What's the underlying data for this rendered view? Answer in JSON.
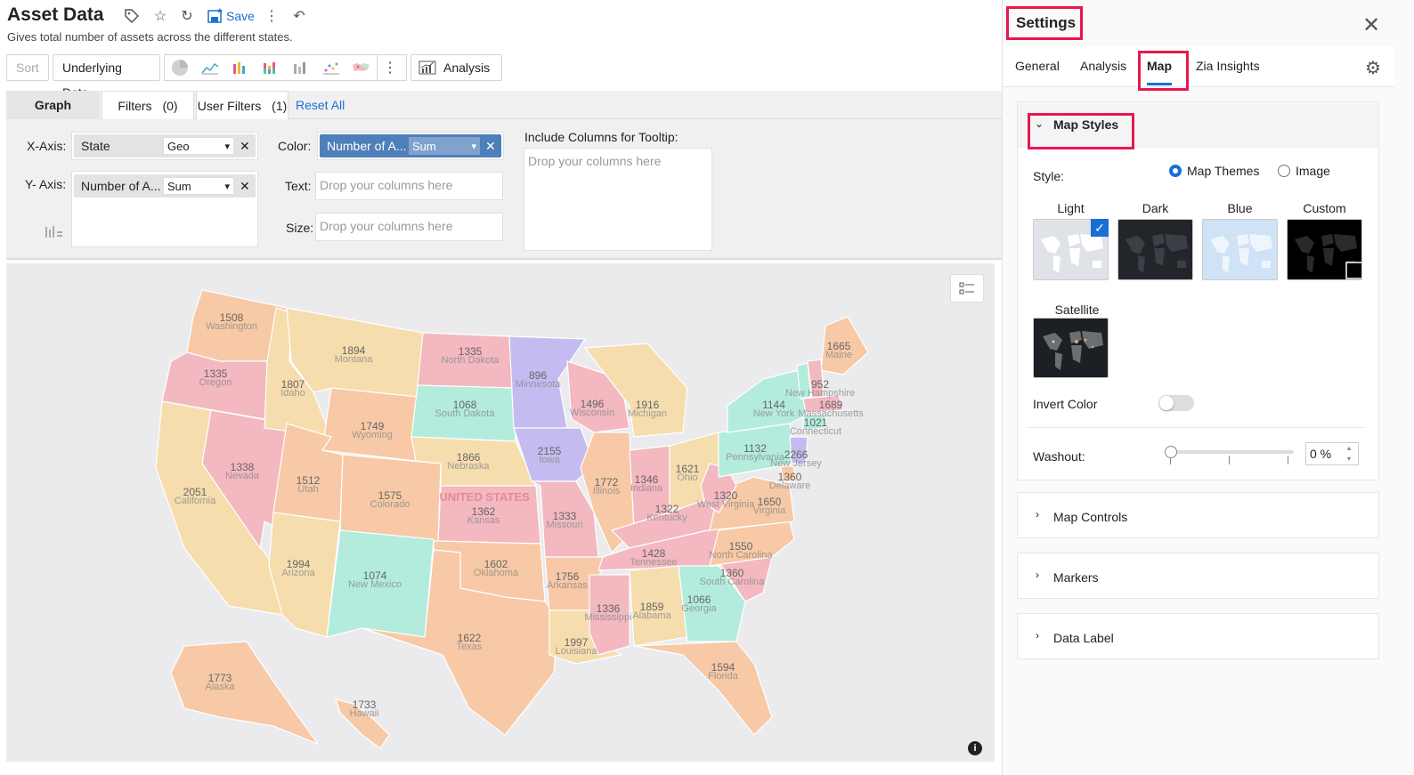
{
  "header": {
    "title": "Asset Data",
    "subtitle": "Gives total number of assets across the different states.",
    "save_label": "Save"
  },
  "toolbar": {
    "sort_label": "Sort",
    "underlying_label": "Underlying Data",
    "analysis_label": "Analysis",
    "chart_icons": [
      "pie-chart-icon",
      "line-chart-icon",
      "bar-chart-icon",
      "stacked-bar-icon",
      "column-chart-icon",
      "scatter-chart-icon",
      "map-chart-icon"
    ]
  },
  "tabs": {
    "graph": "Graph",
    "filters": "Filters",
    "filters_count": "(0)",
    "user_filters": "User Filters",
    "user_filters_count": "(1)",
    "reset_all": "Reset All"
  },
  "shelf": {
    "x_axis_label": "X-Axis:",
    "x_field": "State",
    "x_agg": "Geo",
    "y_axis_label": "Y- Axis:",
    "y_field": "Number of A...",
    "y_agg": "Sum",
    "color_label": "Color:",
    "color_field": "Number of A...",
    "color_agg": "Sum",
    "text_label": "Text:",
    "size_label": "Size:",
    "drop_placeholder": "Drop your columns here",
    "tooltip_label": "Include Columns for Tooltip:"
  },
  "map": {
    "country_label": "UNITED STATES",
    "states": [
      {
        "name": "Washington",
        "value": "1508"
      },
      {
        "name": "Oregon",
        "value": "1335"
      },
      {
        "name": "California",
        "value": "2051"
      },
      {
        "name": "Nevada",
        "value": "1338"
      },
      {
        "name": "Idaho",
        "value": "1807"
      },
      {
        "name": "Montana",
        "value": "1894"
      },
      {
        "name": "Wyoming",
        "value": "1749"
      },
      {
        "name": "Utah",
        "value": "1512"
      },
      {
        "name": "Arizona",
        "value": "1994"
      },
      {
        "name": "Colorado",
        "value": "1575"
      },
      {
        "name": "New Mexico",
        "value": "1074"
      },
      {
        "name": "North Dakota",
        "value": "1335"
      },
      {
        "name": "South Dakota",
        "value": "1068"
      },
      {
        "name": "Nebraska",
        "value": "1866"
      },
      {
        "name": "Kansas",
        "value": "1362"
      },
      {
        "name": "Oklahoma",
        "value": "1602"
      },
      {
        "name": "Texas",
        "value": "1622"
      },
      {
        "name": "Minnesota",
        "value": "896"
      },
      {
        "name": "Iowa",
        "value": "2155"
      },
      {
        "name": "Missouri",
        "value": "1333"
      },
      {
        "name": "Arkansas",
        "value": "1756"
      },
      {
        "name": "Louisiana",
        "value": "1997"
      },
      {
        "name": "Wisconsin",
        "value": "1496"
      },
      {
        "name": "Illinois",
        "value": "1772"
      },
      {
        "name": "Mississippi",
        "value": "1336"
      },
      {
        "name": "Michigan",
        "value": "1916"
      },
      {
        "name": "Indiana",
        "value": "1346"
      },
      {
        "name": "Kentucky",
        "value": "1322"
      },
      {
        "name": "Tennessee",
        "value": "1428"
      },
      {
        "name": "Alabama",
        "value": "1859"
      },
      {
        "name": "Ohio",
        "value": "1621"
      },
      {
        "name": "Georgia",
        "value": "1066"
      },
      {
        "name": "Florida",
        "value": "1594"
      },
      {
        "name": "South Carolina",
        "value": "1360"
      },
      {
        "name": "North Carolina",
        "value": "1550"
      },
      {
        "name": "Virginia",
        "value": "1650"
      },
      {
        "name": "West Virginia",
        "value": "1320"
      },
      {
        "name": "Pennsylvania",
        "value": "1132"
      },
      {
        "name": "New York",
        "value": "1144"
      },
      {
        "name": "New Jersey",
        "value": "2266"
      },
      {
        "name": "Delaware",
        "value": "1360"
      },
      {
        "name": "Maine",
        "value": "1665"
      },
      {
        "name": "New Hampshire",
        "value": "952"
      },
      {
        "name": "Massachusetts",
        "value": "1689"
      },
      {
        "name": "Connecticut",
        "value": "1021"
      },
      {
        "name": "Alaska",
        "value": "1773"
      },
      {
        "name": "Hawaii",
        "value": "1733"
      }
    ]
  },
  "settings": {
    "title": "Settings",
    "tabs": [
      "General",
      "Analysis",
      "Map",
      "Zia Insights"
    ],
    "map_styles_title": "Map Styles",
    "style_label": "Style:",
    "style_option_themes": "Map Themes",
    "style_option_image": "Image",
    "themes": [
      "Light",
      "Dark",
      "Blue",
      "Custom",
      "Satellite"
    ],
    "invert_color_label": "Invert Color",
    "washout_label": "Washout:",
    "washout_value": "0 %",
    "map_controls": "Map Controls",
    "markers": "Markers",
    "data_label": "Data Label"
  },
  "colors": {
    "accent": "#1a6fd6",
    "highlight": "#e8174e",
    "peach": "#f7c9a6",
    "tan": "#f6ddae",
    "pink": "#f3b8c0",
    "mint": "#b3ecdc",
    "lavender": "#c4bcf0"
  }
}
